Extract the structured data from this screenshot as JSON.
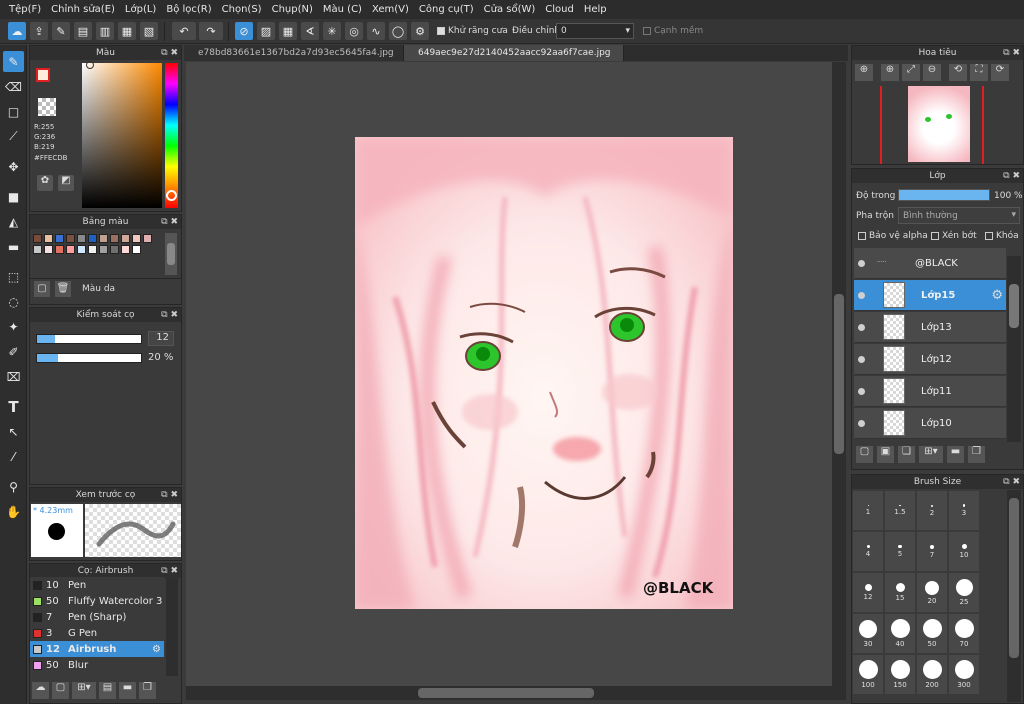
{
  "menu": [
    "Tệp(F)",
    "Chỉnh sửa(E)",
    "Lớp(L)",
    "Bộ lọc(R)",
    "Chọn(S)",
    "Chụp(N)",
    "Màu (C)",
    "Xem(V)",
    "Công cụ(T)",
    "Cửa sổ(W)",
    "Cloud",
    "Help"
  ],
  "toolbar": {
    "antialias_label": "Khử răng cưa",
    "adjust_label": "Điều chỉnh",
    "adjust_value": "0",
    "soft_edge_label": "Cạnh mềm"
  },
  "tabs": [
    "e78bd83661e1367bd2a7d93ec5645fa4.jpg",
    "649aec9e27d2140452aacc92aa6f7cae.jpg"
  ],
  "color_panel": {
    "title": "Màu",
    "r": "R:255",
    "g": "G:236",
    "b": "B:219",
    "hex": "#FFECDB",
    "primary": "#ffecdb",
    "secondary": "#ffffff"
  },
  "palette": {
    "title": "Bảng màu",
    "swatches": [
      "#7a4a3a",
      "#e8c0a0",
      "#3b6fd0",
      "#7a5040",
      "#8a8a8a",
      "#2060c0",
      "#c0a090",
      "#9a7060",
      "#d0a898",
      "#f0c8c0",
      "#e0b0b0",
      "#c8c8c8",
      "#f8e0e0",
      "#e07060",
      "#ff9f9f",
      "#cfe8ff",
      "#f0f0f0",
      "#a0a0a0",
      "#707070",
      "#ffd8d8",
      "#ffffff"
    ],
    "footer_label": "Màu da"
  },
  "brush_control": {
    "title": "Kiểm soát cọ",
    "size": "12",
    "opacity": "20 %",
    "size_fraction": 0.17,
    "opacity_fraction": 0.2
  },
  "brush_preview": {
    "title": "Xem trước cọ",
    "size_label": "* 4.23mm"
  },
  "brush_list": {
    "title": "Cọ: Airbrush",
    "items": [
      {
        "num": "10",
        "name": "Pen",
        "color": "#222222"
      },
      {
        "num": "50",
        "name": "Fluffy Watercolor 3",
        "color": "#9be060"
      },
      {
        "num": "7",
        "name": "Pen (Sharp)",
        "color": "#222222"
      },
      {
        "num": "3",
        "name": "G Pen",
        "color": "#e03030"
      },
      {
        "num": "12",
        "name": "Airbrush",
        "color": "#c8c8c8"
      },
      {
        "num": "50",
        "name": "Blur",
        "color": "#f0a0f0"
      }
    ]
  },
  "navigator": {
    "title": "Hoa tiêu"
  },
  "layers": {
    "title": "Lớp",
    "opacity_label": "Độ trong",
    "opacity_value": "100 %",
    "opacity_fraction": 1.0,
    "blend_label": "Pha trộn",
    "blend_value": "Bình thường",
    "protect_alpha": "Bảo vệ alpha",
    "clipping": "Xén bớt",
    "lock": "Khóa",
    "items": [
      "@BLACK",
      "Lớp15",
      "Lớp13",
      "Lớp12",
      "Lớp11",
      "Lớp10"
    ]
  },
  "brush_size": {
    "title": "Brush Size",
    "sizes": [
      "1",
      "1.5",
      "2",
      "3",
      "4",
      "5",
      "7",
      "10",
      "12",
      "15",
      "20",
      "25",
      "30",
      "40",
      "50",
      "70",
      "100",
      "150",
      "200",
      "300"
    ]
  },
  "artwork": {
    "watermark": "@BLACK"
  }
}
